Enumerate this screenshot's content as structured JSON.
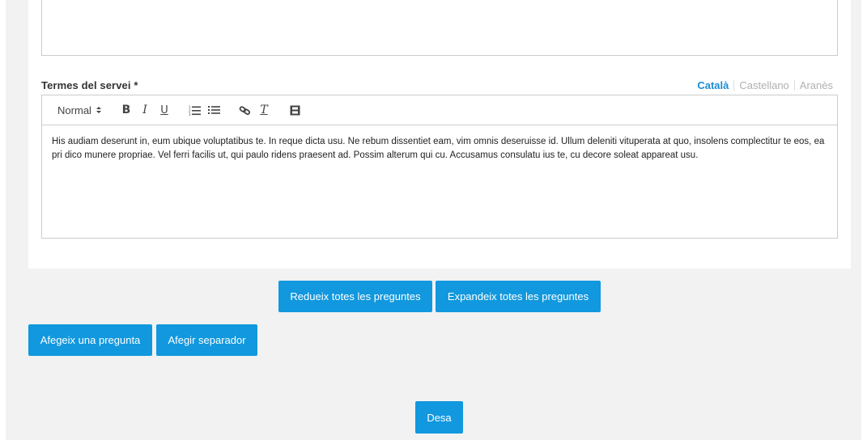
{
  "field": {
    "label": "Termes del servei",
    "required_marker": "*"
  },
  "languages": [
    {
      "label": "Català",
      "active": true
    },
    {
      "label": "Castellano",
      "active": false
    },
    {
      "label": "Aranès",
      "active": false
    }
  ],
  "toolbar": {
    "format_select": "Normal",
    "format_caret": "⬍",
    "bold": "B",
    "italic": "I",
    "underline": "U",
    "ordered_list_icon": "ordered-list-icon",
    "bullet_list_icon": "bullet-list-icon",
    "link_icon": "link-icon",
    "clear_format": "T",
    "video_icon": "video-icon"
  },
  "editor": {
    "text": "His audiam deserunt in, eum ubique voluptatibus te. In reque dicta usu. Ne rebum dissentiet eam, vim omnis deseruisse id. Ullum deleniti vituperata at quo, insolens complectitur te eos, ea pri dico munere propriae. Vel ferri facilis ut, qui paulo ridens praesent ad. Possim alterum qui cu. Accusamus consulatu ius te, cu decore soleat appareat usu."
  },
  "buttons": {
    "collapse_all": "Redueix totes les preguntes",
    "expand_all": "Expandeix totes les preguntes",
    "add_question": "Afegeix una pregunta",
    "add_separator": "Afegir separador",
    "save": "Desa"
  },
  "colors": {
    "accent": "#1198de",
    "active_language": "#1b8dd6",
    "spellcheck_underline": "#d9534f"
  }
}
